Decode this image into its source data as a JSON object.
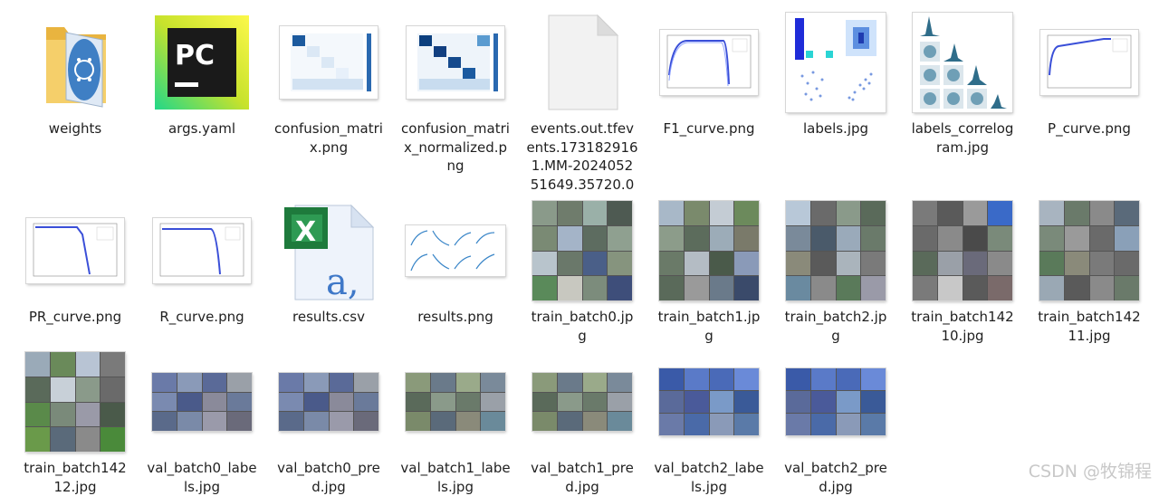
{
  "files": [
    {
      "name": "weights",
      "icon": "folder-icon"
    },
    {
      "name": "args.yaml",
      "icon": "pycharm-icon"
    },
    {
      "name": "confusion_matri\nx.png",
      "icon": "image-thumbnail-icon"
    },
    {
      "name": "confusion_matri\nx_normalized.p\nng",
      "icon": "image-thumbnail-icon"
    },
    {
      "name": "events.out.tfev\nents.173182916\n1.MM-2024052\n51649.35720.0",
      "icon": "generic-file-icon"
    },
    {
      "name": "F1_curve.png",
      "icon": "image-thumbnail-icon"
    },
    {
      "name": "labels.jpg",
      "icon": "image-thumbnail-icon"
    },
    {
      "name": "labels_correlog\nram.jpg",
      "icon": "image-thumbnail-icon"
    },
    {
      "name": "P_curve.png",
      "icon": "image-thumbnail-icon"
    },
    {
      "name": "PR_curve.png",
      "icon": "image-thumbnail-icon"
    },
    {
      "name": "R_curve.png",
      "icon": "image-thumbnail-icon"
    },
    {
      "name": "results.csv",
      "icon": "excel-csv-icon"
    },
    {
      "name": "results.png",
      "icon": "image-thumbnail-icon"
    },
    {
      "name": "train_batch0.jp\ng",
      "icon": "image-thumbnail-icon"
    },
    {
      "name": "train_batch1.jp\ng",
      "icon": "image-thumbnail-icon"
    },
    {
      "name": "train_batch2.jp\ng",
      "icon": "image-thumbnail-icon"
    },
    {
      "name": "train_batch142\n10.jpg",
      "icon": "image-thumbnail-icon"
    },
    {
      "name": "train_batch142\n11.jpg",
      "icon": "image-thumbnail-icon"
    },
    {
      "name": "train_batch142\n12.jpg",
      "icon": "image-thumbnail-icon"
    },
    {
      "name": "val_batch0_labe\nls.jpg",
      "icon": "image-thumbnail-icon"
    },
    {
      "name": "val_batch0_pre\nd.jpg",
      "icon": "image-thumbnail-icon"
    },
    {
      "name": "val_batch1_labe\nls.jpg",
      "icon": "image-thumbnail-icon"
    },
    {
      "name": "val_batch1_pre\nd.jpg",
      "icon": "image-thumbnail-icon"
    },
    {
      "name": "val_batch2_labe\nls.jpg",
      "icon": "image-thumbnail-icon"
    },
    {
      "name": "val_batch2_pre\nd.jpg",
      "icon": "image-thumbnail-icon"
    }
  ],
  "icon_glyphs": {
    "pycharm": "PC",
    "excel": "X",
    "csv_letter": "a,"
  },
  "watermark": "CSDN @牧锦程",
  "colors": {
    "folder": "#f3c85a",
    "pycharm_bg": "#1a1a1a",
    "excel_green": "#1e7a3c",
    "plot_blue": "#3a4fd8"
  }
}
